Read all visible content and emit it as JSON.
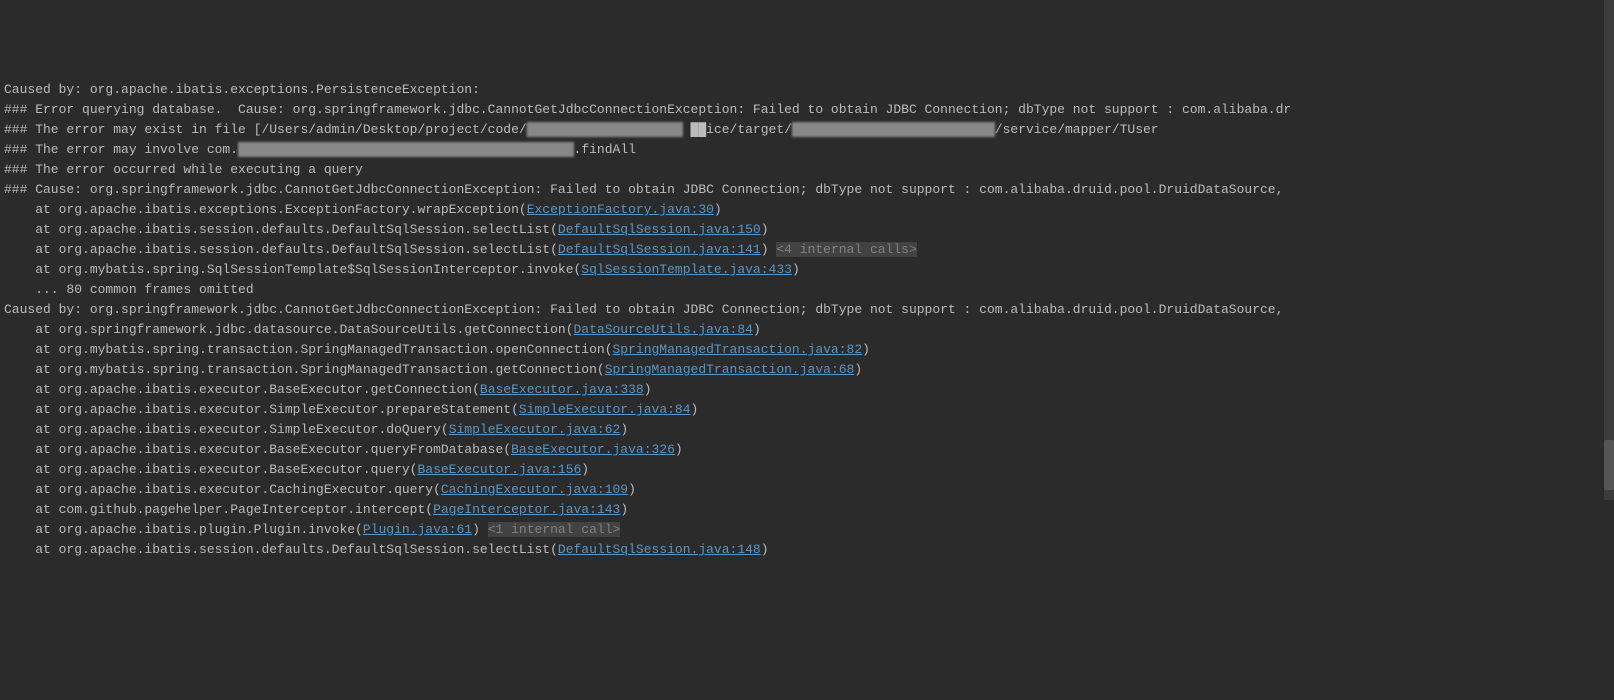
{
  "console": {
    "lines": [
      {
        "pre": "Caused by: org.apache.ibatis.exceptions.PersistenceException:"
      },
      {
        "pre": "### Error querying database.  Cause: org.springframework.jdbc.CannotGetJdbcConnectionException: Failed to obtain JDBC Connection; dbType not support : com.alibaba.dr"
      },
      {
        "pre": "### The error may exist in file [/Users/admin/Desktop/project/code/",
        "censor1": "████████████████████",
        "mid": " ██ice/target/",
        "censor2": "██████████████████████████",
        "post": "/service/mapper/TUser"
      },
      {
        "pre": "### The error may involve com.",
        "censor1": "███████████████████████████████████████████",
        "post": ".findAll"
      },
      {
        "pre": "### The error occurred while executing a query"
      },
      {
        "pre": "### Cause: org.springframework.jdbc.CannotGetJdbcConnectionException: Failed to obtain JDBC Connection; dbType not support : com.alibaba.druid.pool.DruidDataSource,"
      },
      {
        "pre": "    at org.apache.ibatis.exceptions.ExceptionFactory.wrapException(",
        "link": "ExceptionFactory.java:30",
        "post": ")"
      },
      {
        "pre": "    at org.apache.ibatis.session.defaults.DefaultSqlSession.selectList(",
        "link": "DefaultSqlSession.java:150",
        "post": ")"
      },
      {
        "pre": "    at org.apache.ibatis.session.defaults.DefaultSqlSession.selectList(",
        "link": "DefaultSqlSession.java:141",
        "post": ") ",
        "internal": "<4 internal calls>"
      },
      {
        "pre": "    at org.mybatis.spring.SqlSessionTemplate$SqlSessionInterceptor.invoke(",
        "link": "SqlSessionTemplate.java:433",
        "post": ")"
      },
      {
        "pre": "    ... 80 common frames omitted"
      },
      {
        "pre": "Caused by: org.springframework.jdbc.CannotGetJdbcConnectionException: Failed to obtain JDBC Connection; dbType not support : com.alibaba.druid.pool.DruidDataSource,"
      },
      {
        "pre": "    at org.springframework.jdbc.datasource.DataSourceUtils.getConnection(",
        "link": "DataSourceUtils.java:84",
        "post": ")"
      },
      {
        "pre": "    at org.mybatis.spring.transaction.SpringManagedTransaction.openConnection(",
        "link": "SpringManagedTransaction.java:82",
        "post": ")"
      },
      {
        "pre": "    at org.mybatis.spring.transaction.SpringManagedTransaction.getConnection(",
        "link": "SpringManagedTransaction.java:68",
        "post": ")"
      },
      {
        "pre": "    at org.apache.ibatis.executor.BaseExecutor.getConnection(",
        "link": "BaseExecutor.java:338",
        "post": ")"
      },
      {
        "pre": "    at org.apache.ibatis.executor.SimpleExecutor.prepareStatement(",
        "link": "SimpleExecutor.java:84",
        "post": ")"
      },
      {
        "pre": "    at org.apache.ibatis.executor.SimpleExecutor.doQuery(",
        "link": "SimpleExecutor.java:62",
        "post": ")"
      },
      {
        "pre": "    at org.apache.ibatis.executor.BaseExecutor.queryFromDatabase(",
        "link": "BaseExecutor.java:326",
        "post": ")"
      },
      {
        "pre": "    at org.apache.ibatis.executor.BaseExecutor.query(",
        "link": "BaseExecutor.java:156",
        "post": ")"
      },
      {
        "pre": "    at org.apache.ibatis.executor.CachingExecutor.query(",
        "link": "CachingExecutor.java:109",
        "post": ")"
      },
      {
        "pre": "    at com.github.pagehelper.PageInterceptor.intercept(",
        "link": "PageInterceptor.java:143",
        "post": ")"
      },
      {
        "pre": "    at org.apache.ibatis.plugin.Plugin.invoke(",
        "link": "Plugin.java:61",
        "post": ") ",
        "internal": "<1 internal call>"
      },
      {
        "pre": "    at org.apache.ibatis.session.defaults.DefaultSqlSession.selectList(",
        "link": "DefaultSqlSession.java:148",
        "post": ")"
      }
    ]
  },
  "scrollbar": {
    "thumbTop": "440px",
    "thumbHeight": "50px"
  }
}
